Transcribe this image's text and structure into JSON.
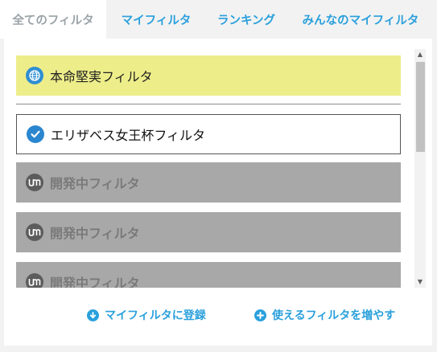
{
  "tabs": [
    {
      "label": "全てのフィルタ",
      "active": true
    },
    {
      "label": "マイフィルタ",
      "active": false
    },
    {
      "label": "ランキング",
      "active": false
    },
    {
      "label": "みんなのマイフィルタ",
      "active": false
    }
  ],
  "filters": {
    "featured": {
      "label": "本命堅実フィルタ",
      "icon": "globe-icon"
    },
    "selected": {
      "label": "エリザベス女王杯フィルタ",
      "icon": "check-circle-icon"
    },
    "in_development": [
      {
        "label": "開発中フィルタ",
        "icon": "um-logo-icon"
      },
      {
        "label": "開発中フィルタ",
        "icon": "um-logo-icon"
      },
      {
        "label": "開発中フィルタ",
        "icon": "um-logo-icon"
      }
    ]
  },
  "actions": {
    "register": {
      "label": "マイフィルタに登録",
      "icon": "arrow-down-circle-icon"
    },
    "add_more": {
      "label": "使えるフィルタを増やす",
      "icon": "plus-circle-icon"
    }
  },
  "colors": {
    "accent": "#2aa0dc",
    "featured_bg": "#eded8a",
    "disabled_bg": "#a8a8a8"
  }
}
